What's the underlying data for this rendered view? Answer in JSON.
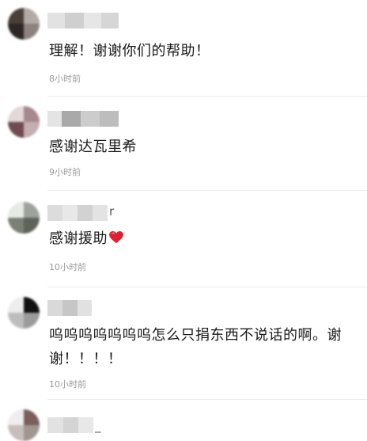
{
  "comments": [
    {
      "text": "理解！谢谢你们的帮助！",
      "time": "8小时前"
    },
    {
      "text": "感谢达瓦里希",
      "time": "9小时前"
    },
    {
      "name_tail": "r",
      "text": "感谢援助",
      "emoji": "red-heart-emoji",
      "time": "10小时前"
    },
    {
      "text": "呜呜呜呜呜呜呜怎么只捐东西不说话的啊。谢谢！！！！",
      "time": "10小时前"
    },
    {
      "name_tail": "_"
    }
  ],
  "colors": {
    "text": "#1a1a1a",
    "time": "#9a9a9a",
    "divider": "#ececec",
    "heart": "#e0202e"
  }
}
